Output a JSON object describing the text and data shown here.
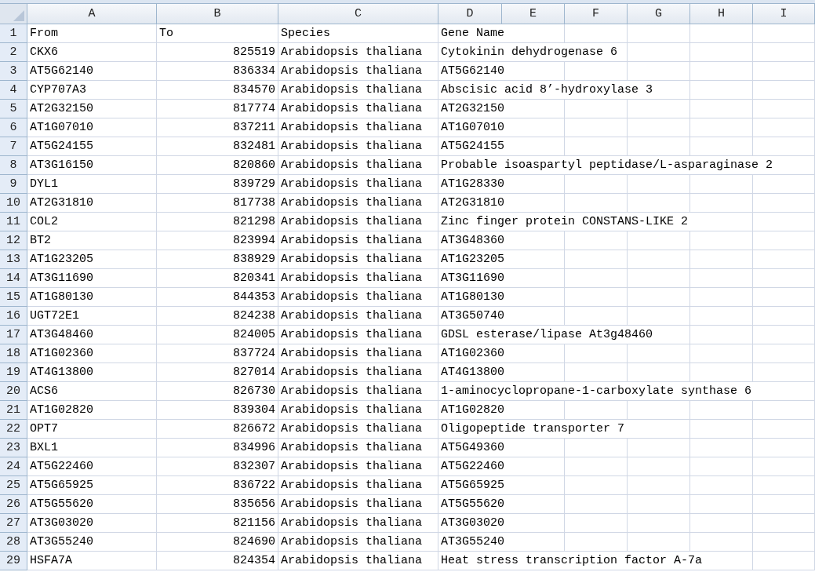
{
  "column_headers": [
    "A",
    "B",
    "C",
    "D",
    "E",
    "F",
    "G",
    "H",
    "I"
  ],
  "rows": [
    {
      "number": "1",
      "kind": "header",
      "cells": [
        "From",
        "To",
        "Species",
        "Gene Name"
      ]
    },
    {
      "number": "2",
      "kind": "data",
      "cells": [
        "CKX6",
        "825519",
        "Arabidopsis thaliana",
        "Cytokinin dehydrogenase 6"
      ]
    },
    {
      "number": "3",
      "kind": "data",
      "cells": [
        "AT5G62140",
        "836334",
        "Arabidopsis thaliana",
        "AT5G62140"
      ]
    },
    {
      "number": "4",
      "kind": "data",
      "cells": [
        "CYP707A3",
        "834570",
        "Arabidopsis thaliana",
        "Abscisic acid 8’-hydroxylase 3"
      ]
    },
    {
      "number": "5",
      "kind": "data",
      "cells": [
        "AT2G32150",
        "817774",
        "Arabidopsis thaliana",
        "AT2G32150"
      ]
    },
    {
      "number": "6",
      "kind": "data",
      "cells": [
        "AT1G07010",
        "837211",
        "Arabidopsis thaliana",
        "AT1G07010"
      ]
    },
    {
      "number": "7",
      "kind": "data",
      "cells": [
        "AT5G24155",
        "832481",
        "Arabidopsis thaliana",
        "AT5G24155"
      ]
    },
    {
      "number": "8",
      "kind": "data",
      "cells": [
        "AT3G16150",
        "820860",
        "Arabidopsis thaliana",
        "Probable isoaspartyl peptidase/L-asparaginase 2"
      ]
    },
    {
      "number": "9",
      "kind": "data",
      "cells": [
        "DYL1",
        "839729",
        "Arabidopsis thaliana",
        "AT1G28330"
      ]
    },
    {
      "number": "10",
      "kind": "data",
      "cells": [
        "AT2G31810",
        "817738",
        "Arabidopsis thaliana",
        "AT2G31810"
      ]
    },
    {
      "number": "11",
      "kind": "data",
      "cells": [
        "COL2",
        "821298",
        "Arabidopsis thaliana",
        "Zinc finger protein CONSTANS-LIKE 2"
      ]
    },
    {
      "number": "12",
      "kind": "data",
      "cells": [
        "BT2",
        "823994",
        "Arabidopsis thaliana",
        "AT3G48360"
      ]
    },
    {
      "number": "13",
      "kind": "data",
      "cells": [
        "AT1G23205",
        "838929",
        "Arabidopsis thaliana",
        "AT1G23205"
      ]
    },
    {
      "number": "14",
      "kind": "data",
      "cells": [
        "AT3G11690",
        "820341",
        "Arabidopsis thaliana",
        "AT3G11690"
      ]
    },
    {
      "number": "15",
      "kind": "data",
      "cells": [
        "AT1G80130",
        "844353",
        "Arabidopsis thaliana",
        "AT1G80130"
      ]
    },
    {
      "number": "16",
      "kind": "data",
      "cells": [
        "UGT72E1",
        "824238",
        "Arabidopsis thaliana",
        "AT3G50740"
      ]
    },
    {
      "number": "17",
      "kind": "data",
      "cells": [
        "AT3G48460",
        "824005",
        "Arabidopsis thaliana",
        "GDSL esterase/lipase At3g48460"
      ]
    },
    {
      "number": "18",
      "kind": "data",
      "cells": [
        "AT1G02360",
        "837724",
        "Arabidopsis thaliana",
        "AT1G02360"
      ]
    },
    {
      "number": "19",
      "kind": "data",
      "cells": [
        "AT4G13800",
        "827014",
        "Arabidopsis thaliana",
        "AT4G13800"
      ]
    },
    {
      "number": "20",
      "kind": "data",
      "cells": [
        "ACS6",
        "826730",
        "Arabidopsis thaliana",
        "1-aminocyclopropane-1-carboxylate synthase 6"
      ]
    },
    {
      "number": "21",
      "kind": "data",
      "cells": [
        "AT1G02820",
        "839304",
        "Arabidopsis thaliana",
        "AT1G02820"
      ]
    },
    {
      "number": "22",
      "kind": "data",
      "cells": [
        "OPT7",
        "826672",
        "Arabidopsis thaliana",
        "Oligopeptide transporter 7"
      ]
    },
    {
      "number": "23",
      "kind": "data",
      "cells": [
        "BXL1",
        "834996",
        "Arabidopsis thaliana",
        "AT5G49360"
      ]
    },
    {
      "number": "24",
      "kind": "data",
      "cells": [
        "AT5G22460",
        "832307",
        "Arabidopsis thaliana",
        "AT5G22460"
      ]
    },
    {
      "number": "25",
      "kind": "data",
      "cells": [
        "AT5G65925",
        "836722",
        "Arabidopsis thaliana",
        "AT5G65925"
      ]
    },
    {
      "number": "26",
      "kind": "data",
      "cells": [
        "AT5G55620",
        "835656",
        "Arabidopsis thaliana",
        "AT5G55620"
      ]
    },
    {
      "number": "27",
      "kind": "data",
      "cells": [
        "AT3G03020",
        "821156",
        "Arabidopsis thaliana",
        "AT3G03020"
      ]
    },
    {
      "number": "28",
      "kind": "data",
      "cells": [
        "AT3G55240",
        "824690",
        "Arabidopsis thaliana",
        "AT3G55240"
      ]
    },
    {
      "number": "29",
      "kind": "data",
      "cells": [
        "HSFA7A",
        "824354",
        "Arabidopsis thaliana",
        "Heat stress transcription factor A-7a"
      ]
    }
  ]
}
